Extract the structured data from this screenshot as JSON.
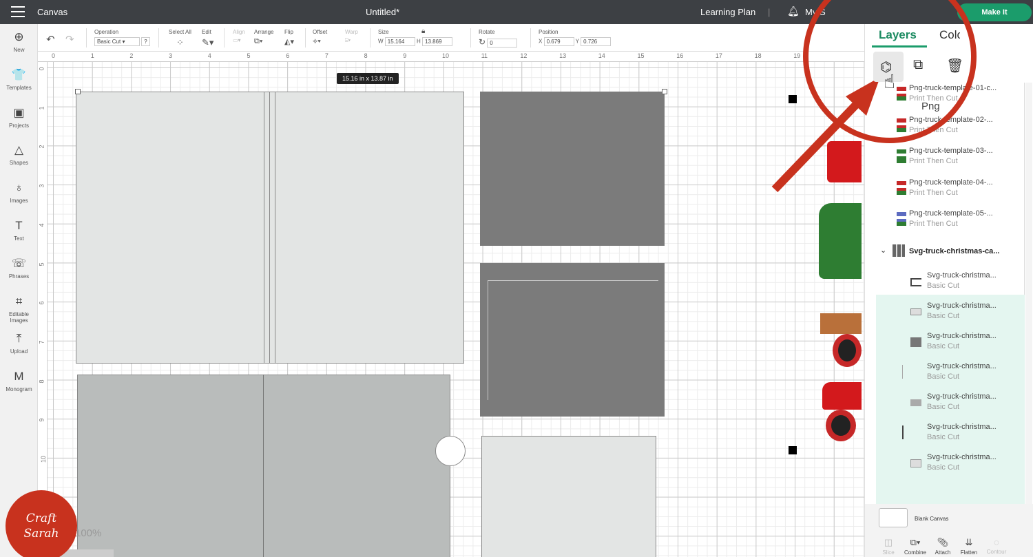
{
  "topbar": {
    "title": "Canvas",
    "document": "Untitled*",
    "learning": "Learning Plan",
    "my": "My S",
    "make_it": "Make It"
  },
  "sidebar": [
    {
      "label": "New",
      "icon": "⊕"
    },
    {
      "label": "Templates",
      "icon": "👕"
    },
    {
      "label": "Projects",
      "icon": "▣"
    },
    {
      "label": "Shapes",
      "icon": "△"
    },
    {
      "label": "Images",
      "icon": "♁"
    },
    {
      "label": "Text",
      "icon": "T"
    },
    {
      "label": "Phrases",
      "icon": "☏"
    },
    {
      "label": "Editable Images",
      "icon": "⌗"
    },
    {
      "label": "Upload",
      "icon": "⤒"
    },
    {
      "label": "Monogram",
      "icon": "M"
    }
  ],
  "toolbar": {
    "operation_label": "Operation",
    "operation_value": "Basic Cut",
    "help": "?",
    "select_all": "Select All",
    "edit": "Edit",
    "align": "Align",
    "arrange": "Arrange",
    "flip": "Flip",
    "offset": "Offset",
    "warp": "Warp",
    "size": "Size",
    "w_label": "W",
    "w": "15.164",
    "h_label": "H",
    "h": "13.869",
    "rotate": "Rotate",
    "rotate_value": "0",
    "position": "Position",
    "x_label": "X",
    "x": "0.679",
    "y_label": "Y",
    "y": "0.726"
  },
  "ruler": {
    "h": [
      "0",
      "1",
      "2",
      "3",
      "4",
      "5",
      "6",
      "7",
      "8",
      "9",
      "10",
      "11",
      "12",
      "13",
      "14",
      "15",
      "16",
      "17",
      "18",
      "19"
    ],
    "v": [
      "0",
      "1",
      "2",
      "3",
      "4",
      "5",
      "6",
      "7",
      "8",
      "9",
      "10"
    ]
  },
  "canvas": {
    "dimension_tooltip": "15.16  in x 13.87  in",
    "zoom": "100%"
  },
  "panel": {
    "tab_layers": "Layers",
    "tab_color": "Color",
    "layers": [
      {
        "name": "Png-truck-template-01-c...",
        "sub": "Print Then Cut"
      },
      {
        "name": "Png-truck-template-02-...",
        "sub": "Print Then Cut"
      },
      {
        "name": "Png-truck-template-03-...",
        "sub": "Print Then Cut"
      },
      {
        "name": "Png-truck-template-04-...",
        "sub": "Print Then Cut"
      },
      {
        "name": "Png-truck-template-05-...",
        "sub": "Print Then Cut"
      }
    ],
    "group": "Svg-truck-christmas-ca...",
    "children": [
      {
        "name": "Svg-truck-christma...",
        "sub": "Basic Cut"
      },
      {
        "name": "Svg-truck-christma...",
        "sub": "Basic Cut"
      },
      {
        "name": "Svg-truck-christma...",
        "sub": "Basic Cut"
      },
      {
        "name": "Svg-truck-christma...",
        "sub": "Basic Cut"
      },
      {
        "name": "Svg-truck-christma...",
        "sub": "Basic Cut"
      },
      {
        "name": "Svg-truck-christma...",
        "sub": "Basic Cut"
      },
      {
        "name": "Svg-truck-christma...",
        "sub": "Basic Cut"
      }
    ],
    "blank_canvas": "Blank Canvas",
    "actions": [
      "Slice",
      "Combine",
      "Attach",
      "Flatten",
      "Contour"
    ]
  },
  "overlay": {
    "zoomed_label": "Png",
    "watermark": "Craft with Sarah"
  },
  "colors": {
    "accent": "#1b9c6b",
    "annotation": "#c8321e",
    "group_bg": "#e4f6f0"
  }
}
